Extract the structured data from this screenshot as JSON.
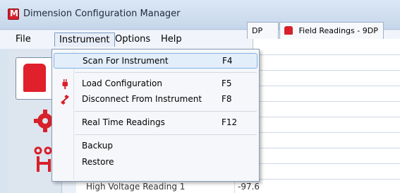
{
  "window": {
    "title": "Dimension Configuration Manager"
  },
  "menubar": {
    "file": "File",
    "instrument": "Instrument",
    "options": "Options",
    "help": "Help"
  },
  "instrument_menu": {
    "scan": {
      "label": "Scan For Instrument",
      "shortcut": "F4"
    },
    "load": {
      "label": "Load Configuration",
      "shortcut": "F5"
    },
    "disconnect": {
      "label": "Disconnect From Instrument",
      "shortcut": "F8"
    },
    "realtime": {
      "label": "Real Time Readings",
      "shortcut": "F12"
    },
    "backup": {
      "label": "Backup"
    },
    "restore": {
      "label": "Restore"
    }
  },
  "tabs": {
    "partial": "DP",
    "field_readings": "Field Readings - 9DP"
  },
  "grid": {
    "row_label": "High Voltage Reading 1",
    "row_value": "-97.6"
  },
  "icons": {
    "app": "app-logo-icon",
    "plug": "plug-icon",
    "disconnect": "disconnect-icon",
    "gear": "gear-icon",
    "network": "network-icon"
  },
  "colors": {
    "accent": "#d7202a",
    "highlight": "#e3eefb"
  }
}
